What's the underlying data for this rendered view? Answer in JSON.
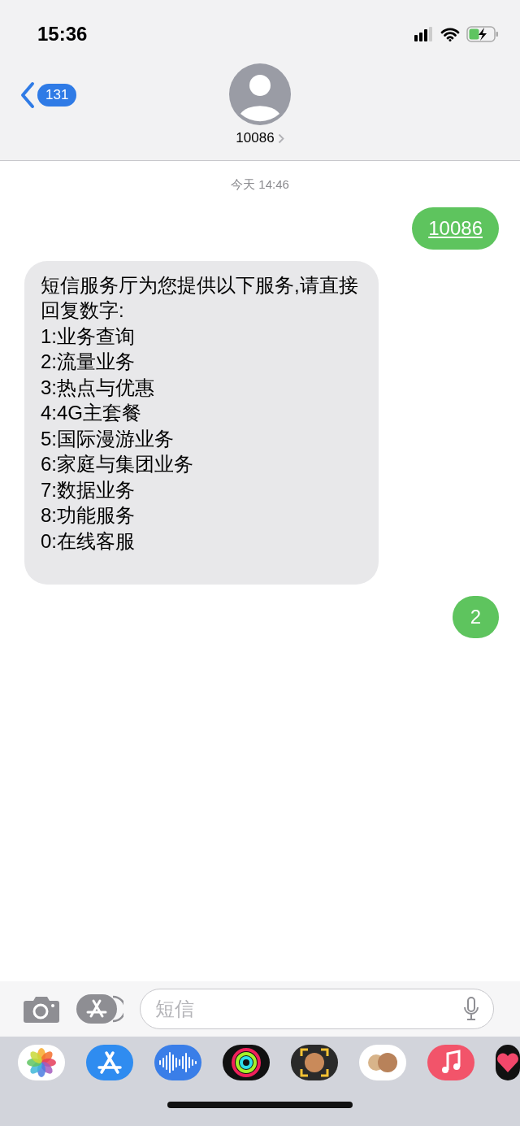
{
  "status_bar": {
    "time": "15:36"
  },
  "header": {
    "back_badge": "131",
    "contact": "10086"
  },
  "timestamp": "今天 14:46",
  "messages": [
    {
      "kind": "sent",
      "link": "10086"
    },
    {
      "kind": "received",
      "text": "短信服务厅为您提供以下服务,请直接回复数字:\n1:业务查询\n2:流量业务\n3:热点与优惠\n4:4G主套餐\n5:国际漫游业务\n6:家庭与集团业务\n7:数据业务\n8:功能服务\n0:在线客服"
    },
    {
      "kind": "sent",
      "text": "2"
    }
  ],
  "input": {
    "placeholder": "短信"
  },
  "app_drawer": [
    {
      "kind": "photos"
    },
    {
      "kind": "appstore"
    },
    {
      "kind": "audio"
    },
    {
      "kind": "activity"
    },
    {
      "kind": "memoji"
    },
    {
      "kind": "stickers"
    },
    {
      "kind": "music"
    },
    {
      "kind": "heart"
    }
  ]
}
